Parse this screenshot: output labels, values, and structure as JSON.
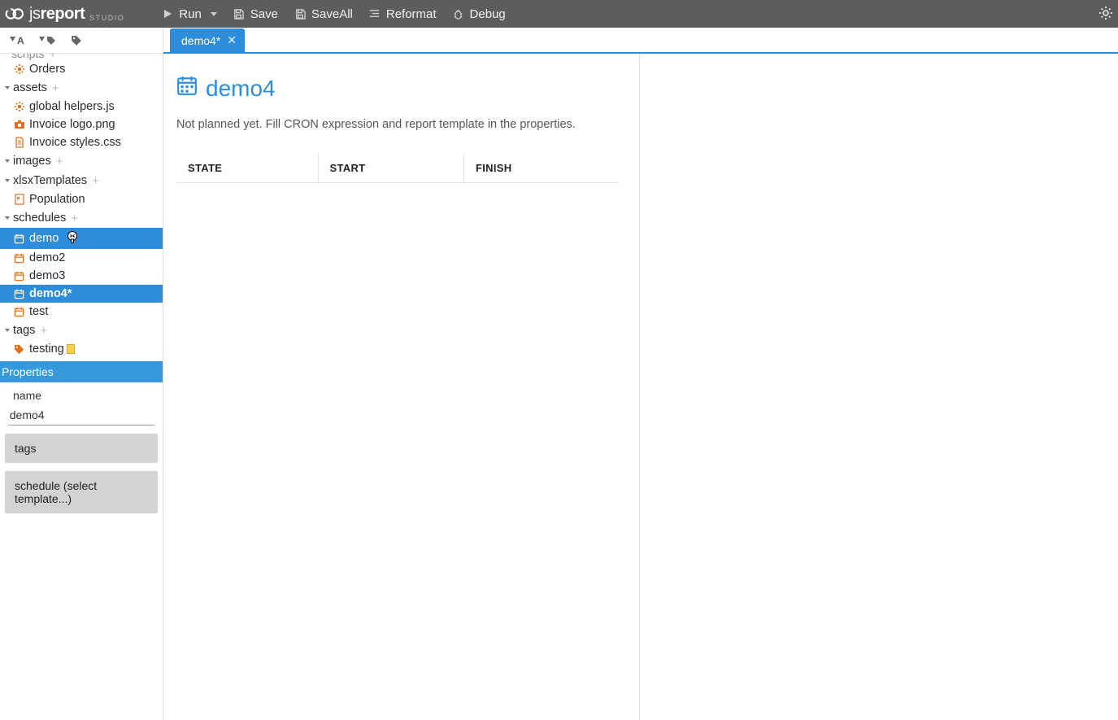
{
  "brand": {
    "name_light": "js",
    "name_bold": "report",
    "studio": "STUDIO"
  },
  "toolbar": {
    "run": "Run",
    "save": "Save",
    "save_all": "SaveAll",
    "reformat": "Reformat",
    "debug": "Debug"
  },
  "tree": {
    "scripts_label": "scripts",
    "orders_label": "Orders",
    "assets_label": "assets",
    "asset_helpers": "global helpers.js",
    "asset_logo": "Invoice logo.png",
    "asset_styles": "Invoice styles.css",
    "images_label": "images",
    "xlsx_label": "xlsxTemplates",
    "population": "Population",
    "schedules_label": "schedules",
    "sched_demo": "demo",
    "sched_demo2": "demo2",
    "sched_demo3": "demo3",
    "sched_demo4": "demo4*",
    "sched_test": "test",
    "tags_label": "tags",
    "tag_testing": "testing"
  },
  "properties": {
    "title": "Properties",
    "name_label": "name",
    "name_value": "demo4",
    "tags_label": "tags",
    "schedule_label": "schedule (select template...)"
  },
  "tabs": {
    "active_label": "demo4*"
  },
  "page": {
    "title": "demo4",
    "subtitle": "Not planned yet. Fill CRON expression and report template in the properties.",
    "col_state": "STATE",
    "col_start": "START",
    "col_finish": "FINISH"
  }
}
